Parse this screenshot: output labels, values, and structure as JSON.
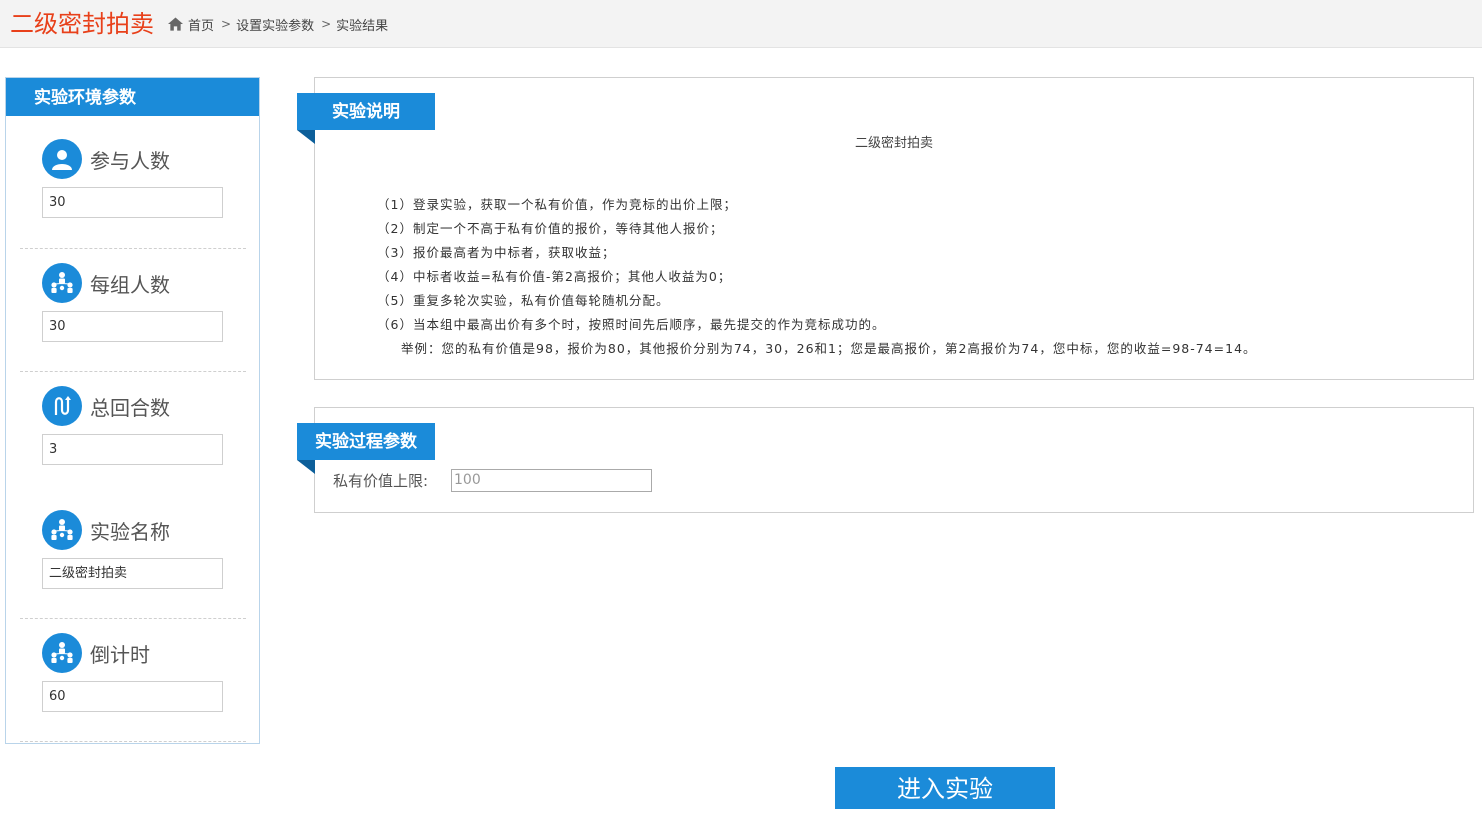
{
  "header": {
    "app_title": "二级密封拍卖",
    "breadcrumb": {
      "home": "首页",
      "step2": "设置实验参数",
      "step3": "实验结果"
    }
  },
  "left_panel": {
    "title": "实验环境参数",
    "params": [
      {
        "label": "参与人数",
        "value": "30",
        "icon": "user-icon"
      },
      {
        "label": "每组人数",
        "value": "30",
        "icon": "group-icon"
      },
      {
        "label": "总回合数",
        "value": "3",
        "icon": "rounds-icon"
      },
      {
        "label": "实验名称",
        "value": "二级密封拍卖",
        "icon": "group-icon"
      },
      {
        "label": "倒计时",
        "value": "60",
        "icon": "group-icon"
      }
    ]
  },
  "intro": {
    "tab": "实验说明",
    "title": "二级密封拍卖",
    "rules": [
      "（1）登录实验，获取一个私有价值，作为竞标的出价上限；",
      "（2）制定一个不高于私有价值的报价，等待其他人报价；",
      "（3）报价最高者为中标者，获取收益；",
      "（4）中标者收益=私有价值-第2高报价；其他人收益为0；",
      "（5）重复多轮次实验，私有价值每轮随机分配。",
      "（6）当本组中最高出价有多个时，按照时间先后顺序，最先提交的作为竞标成功的。"
    ],
    "example": "举例：您的私有价值是98，报价为80，其他报价分别为74，30，26和1；您是最高报价，第2高报价为74，您中标，您的收益=98-74=14。"
  },
  "process": {
    "tab": "实验过程参数",
    "label": "私有价值上限:",
    "value": "100"
  },
  "enter_button": "进入实验",
  "colors": {
    "accent": "#1b8bd9",
    "title_red": "#e8401a"
  }
}
